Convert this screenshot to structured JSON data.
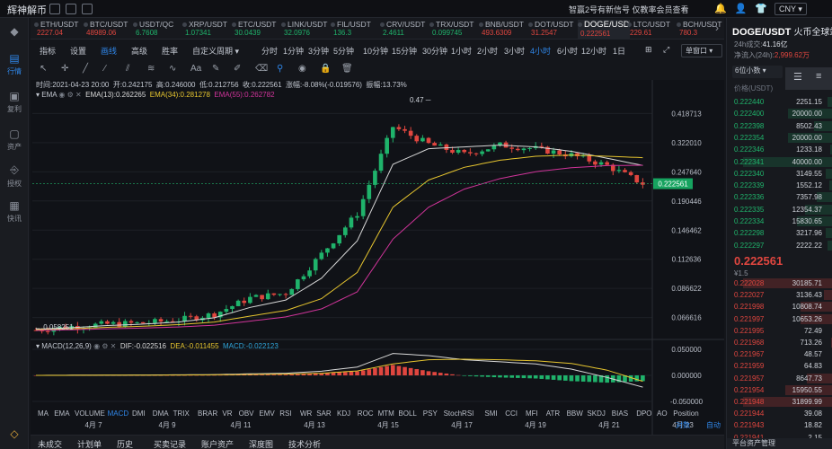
{
  "titlebar": {
    "app_name": "辉神解币",
    "notice": "智赢2号有新信号        仅教率会员查看",
    "currency": "CNY ▾",
    "icons": [
      "bell-icon",
      "user-icon",
      "shirt-icon",
      "minimize-icon",
      "maximize-icon",
      "close-icon"
    ]
  },
  "sidebar": {
    "items": [
      {
        "label": "",
        "icon": "logo-icon"
      },
      {
        "label": "行情",
        "icon": "market-icon"
      },
      {
        "label": "复利",
        "icon": "compound-icon"
      },
      {
        "label": "资产",
        "icon": "asset-icon"
      },
      {
        "label": "授权",
        "icon": "auth-icon"
      },
      {
        "label": "快讯",
        "icon": "news-icon"
      }
    ]
  },
  "tickers": [
    {
      "name": "ETH/USDT",
      "price": "2227.04",
      "dir": "down"
    },
    {
      "name": "BTC/USDT",
      "price": "48989.06",
      "dir": "down"
    },
    {
      "name": "USDT/QC",
      "price": "6.7608",
      "dir": "up"
    },
    {
      "name": "XRP/USDT",
      "price": "1.07341",
      "dir": "up"
    },
    {
      "name": "ETC/USDT",
      "price": "30.0439",
      "dir": "up"
    },
    {
      "name": "LINK/USDT",
      "price": "32.0976",
      "dir": "up"
    },
    {
      "name": "FIL/USDT",
      "price": "136.3",
      "dir": "up"
    },
    {
      "name": "CRV/USDT",
      "price": "2.4611",
      "dir": "up"
    },
    {
      "name": "TRX/USDT",
      "price": "0.099745",
      "dir": "up"
    },
    {
      "name": "BNB/USDT",
      "price": "493.6309",
      "dir": "down"
    },
    {
      "name": "DOT/USDT",
      "price": "31.2547",
      "dir": "down"
    },
    {
      "name": "DOGE/USDT",
      "price": "0.222561",
      "dir": "down"
    },
    {
      "name": "LTC/USDT",
      "price": "229.61",
      "dir": "down"
    },
    {
      "name": "BCH/USDT",
      "price": "780.3",
      "dir": "down"
    }
  ],
  "toolbar": {
    "items": [
      "指标",
      "设置",
      "画线",
      "高级",
      "胜率",
      "自定义周期 ▾",
      "分时",
      "1分钟",
      "3分钟",
      "5分钟",
      "10分钟",
      "15分钟",
      "30分钟",
      "1小时",
      "2小时",
      "3小时",
      "4小时",
      "6小时",
      "12小时",
      "1日"
    ],
    "active_items": [
      "画线",
      "4小时"
    ],
    "chart_mode": "单窗口 ▾",
    "draw_tools": [
      "cursor-icon",
      "cross-icon",
      "ray-icon",
      "line-icon",
      "channel-icon",
      "multi-line-icon",
      "wave-icon",
      "text-icon",
      "brush-icon",
      "pencil-icon",
      "eraser-icon",
      "magnet-icon",
      "hide-icon",
      "lock-icon",
      "delete-icon"
    ]
  },
  "ohlc_line": {
    "time": "时间:2021-04-23 20:00",
    "open": "开:0.242175",
    "high": "高:0.246000",
    "low": "低:0.212756",
    "close": "收:0.222561",
    "change": "涨幅:-8.08%(-0.019576)",
    "amplitude": "振幅:13.73%"
  },
  "ema_legend": {
    "name": "EMA",
    "ema13": "EMA(13):0.262265",
    "ema34": "EMA(34):0.281278",
    "ema55": "EMA(55):0.262782"
  },
  "macd_legend": {
    "name": "MACD(12,26,9)",
    "dif": "DIF:-0.022516",
    "dea": "DEA:-0.011455",
    "macd": "MACD:-0.022123"
  },
  "price_axis": [
    "0.418713",
    "0.322010",
    "0.247640",
    "0.190446",
    "0.146462",
    "0.112636",
    "0.086622",
    "0.066616"
  ],
  "current_price_tag": "0.222561",
  "annotations": {
    "high_label": "0.47 ─",
    "low_label": "← 0.058251"
  },
  "macd_axis": [
    "0.050000",
    "0.000000",
    "-0.050000"
  ],
  "indicator_tabs": [
    "MA",
    "EMA",
    "VOLUME",
    "MACD",
    "DMI",
    "DMA",
    "TRIX",
    "BRAR",
    "VR",
    "OBV",
    "EMV",
    "RSI",
    "WR",
    "SAR",
    "KDJ",
    "ROC",
    "MTM",
    "BOLL",
    "PSY",
    "StochRSI",
    "SMI",
    "CCI",
    "MFI",
    "ATR",
    "BBW",
    "SKDJ",
    "BIAS",
    "DPO",
    "AO",
    "Position"
  ],
  "active_indicator": "MACD",
  "date_axis": [
    "4月 7",
    "4月 9",
    "4月 11",
    "4月 13",
    "4月 15",
    "4月 17",
    "4月 19",
    "4月 21",
    "4月 23"
  ],
  "axis_opts": {
    "log": "对数",
    "auto": "自动"
  },
  "bottom_tabs": [
    "未成交",
    "计划单",
    "历史",
    "买卖记录",
    "账户资产",
    "深度图",
    "技术分析"
  ],
  "right_panel": {
    "pair": "DOGE/USDT",
    "exchange": "火币全球站",
    "vol_label": "24h成交:",
    "vol_value": "41.16亿",
    "inflow_label": "净流入(24h):",
    "inflow_value": "2,999.62万",
    "depth_select": "6位小数 ▾",
    "header": "价格(USDT)",
    "asks": [
      [
        "0.222440",
        "2251.15"
      ],
      [
        "0.222400",
        "20000.00"
      ],
      [
        "0.222398",
        "8502.43"
      ],
      [
        "0.222354",
        "20000.00"
      ],
      [
        "0.222346",
        "1233.18"
      ],
      [
        "0.222341",
        "40000.00"
      ],
      [
        "0.222340",
        "3149.55"
      ],
      [
        "0.222339",
        "1552.12"
      ],
      [
        "0.222336",
        "7357.98"
      ],
      [
        "0.222335",
        "12354.37"
      ],
      [
        "0.222334",
        "15830.65"
      ],
      [
        "0.222298",
        "3217.96"
      ],
      [
        "0.222297",
        "2222.22"
      ]
    ],
    "last_price": "0.222561",
    "last_cny": "¥1.5",
    "bids": [
      [
        "0.222028",
        "30185.71"
      ],
      [
        "0.222027",
        "3136.43"
      ],
      [
        "0.221998",
        "10808.74"
      ],
      [
        "0.221997",
        "10653.26"
      ],
      [
        "0.221995",
        "72.49"
      ],
      [
        "0.221968",
        "713.26"
      ],
      [
        "0.221967",
        "48.57"
      ],
      [
        "0.221959",
        "64.83"
      ],
      [
        "0.221957",
        "8647.73"
      ],
      [
        "0.221954",
        "15950.55"
      ],
      [
        "0.221948",
        "31899.99"
      ],
      [
        "0.221944",
        "39.08"
      ],
      [
        "0.221943",
        "18.82"
      ],
      [
        "0.221941",
        "2.15"
      ]
    ],
    "footer": "平台资产管理"
  },
  "colors": {
    "up": "#1fb36b",
    "down": "#e0463f",
    "accent": "#2f86e8",
    "ema13": "#d8d8d8",
    "ema34": "#e6c52f",
    "ema55": "#d0349a"
  },
  "chart_data": {
    "type": "candlestick",
    "scale": "log",
    "ylim": [
      0.0565,
      0.49
    ],
    "x": [
      "4月 6",
      "4月 7",
      "4月 8",
      "4月 9",
      "4月 10",
      "4月 11",
      "4月 12",
      "4月 13",
      "4月 14",
      "4月 15",
      "4月 16",
      "4月 17",
      "4月 18",
      "4月 19",
      "4月 20",
      "4月 21",
      "4月 22",
      "4月 23"
    ],
    "series": [
      {
        "name": "DOGE/USDT 4小时",
        "close": [
          0.0595,
          0.0615,
          0.0628,
          0.0634,
          0.0652,
          0.0688,
          0.0795,
          0.083,
          0.118,
          0.17,
          0.372,
          0.318,
          0.29,
          0.315,
          0.305,
          0.288,
          0.262,
          0.222561
        ],
        "high": [
          0.0605,
          0.063,
          0.064,
          0.0648,
          0.0665,
          0.072,
          0.085,
          0.089,
          0.125,
          0.19,
          0.47,
          0.375,
          0.33,
          0.35,
          0.345,
          0.32,
          0.29,
          0.246
        ]
      },
      {
        "name": "EMA(13)",
        "values": [
          0.06,
          0.0608,
          0.062,
          0.0628,
          0.064,
          0.0665,
          0.073,
          0.078,
          0.095,
          0.133,
          0.265,
          0.305,
          0.31,
          0.315,
          0.31,
          0.298,
          0.28,
          0.262265
        ]
      },
      {
        "name": "EMA(34)",
        "values": [
          0.0597,
          0.0602,
          0.061,
          0.0616,
          0.0625,
          0.064,
          0.0675,
          0.071,
          0.079,
          0.1,
          0.18,
          0.23,
          0.258,
          0.275,
          0.285,
          0.288,
          0.285,
          0.281278
        ]
      },
      {
        "name": "EMA(55)",
        "values": [
          0.0593,
          0.0597,
          0.0602,
          0.0606,
          0.0612,
          0.0622,
          0.0645,
          0.067,
          0.072,
          0.084,
          0.135,
          0.18,
          0.212,
          0.233,
          0.248,
          0.257,
          0.262,
          0.262782
        ]
      }
    ],
    "macd": {
      "dif": [
        0.0,
        0.0003,
        0.0005,
        0.0007,
        0.001,
        0.0015,
        0.003,
        0.004,
        0.008,
        0.016,
        0.042,
        0.038,
        0.03,
        0.026,
        0.022,
        0.012,
        -0.004,
        -0.022516
      ],
      "dea": [
        0.0,
        0.0001,
        0.0003,
        0.0005,
        0.0007,
        0.001,
        0.0018,
        0.0026,
        0.004,
        0.0085,
        0.022,
        0.03,
        0.031,
        0.03,
        0.028,
        0.023,
        0.01,
        -0.011455
      ]
    }
  }
}
